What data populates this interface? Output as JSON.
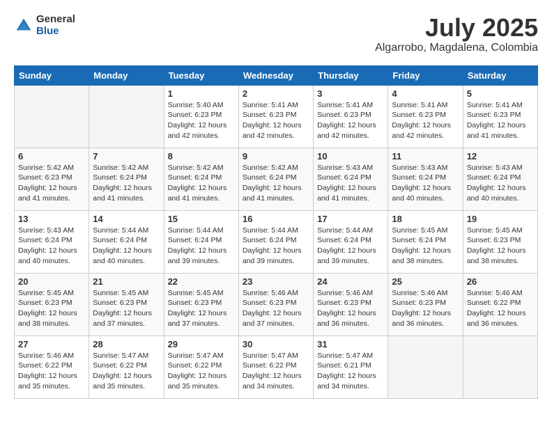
{
  "header": {
    "logo_general": "General",
    "logo_blue": "Blue",
    "month_year": "July 2025",
    "location": "Algarrobo, Magdalena, Colombia"
  },
  "weekdays": [
    "Sunday",
    "Monday",
    "Tuesday",
    "Wednesday",
    "Thursday",
    "Friday",
    "Saturday"
  ],
  "weeks": [
    [
      {
        "day": "",
        "info": ""
      },
      {
        "day": "",
        "info": ""
      },
      {
        "day": "1",
        "info": "Sunrise: 5:40 AM\nSunset: 6:23 PM\nDaylight: 12 hours and 42 minutes."
      },
      {
        "day": "2",
        "info": "Sunrise: 5:41 AM\nSunset: 6:23 PM\nDaylight: 12 hours and 42 minutes."
      },
      {
        "day": "3",
        "info": "Sunrise: 5:41 AM\nSunset: 6:23 PM\nDaylight: 12 hours and 42 minutes."
      },
      {
        "day": "4",
        "info": "Sunrise: 5:41 AM\nSunset: 6:23 PM\nDaylight: 12 hours and 42 minutes."
      },
      {
        "day": "5",
        "info": "Sunrise: 5:41 AM\nSunset: 6:23 PM\nDaylight: 12 hours and 41 minutes."
      }
    ],
    [
      {
        "day": "6",
        "info": "Sunrise: 5:42 AM\nSunset: 6:23 PM\nDaylight: 12 hours and 41 minutes."
      },
      {
        "day": "7",
        "info": "Sunrise: 5:42 AM\nSunset: 6:24 PM\nDaylight: 12 hours and 41 minutes."
      },
      {
        "day": "8",
        "info": "Sunrise: 5:42 AM\nSunset: 6:24 PM\nDaylight: 12 hours and 41 minutes."
      },
      {
        "day": "9",
        "info": "Sunrise: 5:42 AM\nSunset: 6:24 PM\nDaylight: 12 hours and 41 minutes."
      },
      {
        "day": "10",
        "info": "Sunrise: 5:43 AM\nSunset: 6:24 PM\nDaylight: 12 hours and 41 minutes."
      },
      {
        "day": "11",
        "info": "Sunrise: 5:43 AM\nSunset: 6:24 PM\nDaylight: 12 hours and 40 minutes."
      },
      {
        "day": "12",
        "info": "Sunrise: 5:43 AM\nSunset: 6:24 PM\nDaylight: 12 hours and 40 minutes."
      }
    ],
    [
      {
        "day": "13",
        "info": "Sunrise: 5:43 AM\nSunset: 6:24 PM\nDaylight: 12 hours and 40 minutes."
      },
      {
        "day": "14",
        "info": "Sunrise: 5:44 AM\nSunset: 6:24 PM\nDaylight: 12 hours and 40 minutes."
      },
      {
        "day": "15",
        "info": "Sunrise: 5:44 AM\nSunset: 6:24 PM\nDaylight: 12 hours and 39 minutes."
      },
      {
        "day": "16",
        "info": "Sunrise: 5:44 AM\nSunset: 6:24 PM\nDaylight: 12 hours and 39 minutes."
      },
      {
        "day": "17",
        "info": "Sunrise: 5:44 AM\nSunset: 6:24 PM\nDaylight: 12 hours and 39 minutes."
      },
      {
        "day": "18",
        "info": "Sunrise: 5:45 AM\nSunset: 6:24 PM\nDaylight: 12 hours and 38 minutes."
      },
      {
        "day": "19",
        "info": "Sunrise: 5:45 AM\nSunset: 6:23 PM\nDaylight: 12 hours and 38 minutes."
      }
    ],
    [
      {
        "day": "20",
        "info": "Sunrise: 5:45 AM\nSunset: 6:23 PM\nDaylight: 12 hours and 38 minutes."
      },
      {
        "day": "21",
        "info": "Sunrise: 5:45 AM\nSunset: 6:23 PM\nDaylight: 12 hours and 37 minutes."
      },
      {
        "day": "22",
        "info": "Sunrise: 5:45 AM\nSunset: 6:23 PM\nDaylight: 12 hours and 37 minutes."
      },
      {
        "day": "23",
        "info": "Sunrise: 5:46 AM\nSunset: 6:23 PM\nDaylight: 12 hours and 37 minutes."
      },
      {
        "day": "24",
        "info": "Sunrise: 5:46 AM\nSunset: 6:23 PM\nDaylight: 12 hours and 36 minutes."
      },
      {
        "day": "25",
        "info": "Sunrise: 5:46 AM\nSunset: 6:23 PM\nDaylight: 12 hours and 36 minutes."
      },
      {
        "day": "26",
        "info": "Sunrise: 5:46 AM\nSunset: 6:22 PM\nDaylight: 12 hours and 36 minutes."
      }
    ],
    [
      {
        "day": "27",
        "info": "Sunrise: 5:46 AM\nSunset: 6:22 PM\nDaylight: 12 hours and 35 minutes."
      },
      {
        "day": "28",
        "info": "Sunrise: 5:47 AM\nSunset: 6:22 PM\nDaylight: 12 hours and 35 minutes."
      },
      {
        "day": "29",
        "info": "Sunrise: 5:47 AM\nSunset: 6:22 PM\nDaylight: 12 hours and 35 minutes."
      },
      {
        "day": "30",
        "info": "Sunrise: 5:47 AM\nSunset: 6:22 PM\nDaylight: 12 hours and 34 minutes."
      },
      {
        "day": "31",
        "info": "Sunrise: 5:47 AM\nSunset: 6:21 PM\nDaylight: 12 hours and 34 minutes."
      },
      {
        "day": "",
        "info": ""
      },
      {
        "day": "",
        "info": ""
      }
    ]
  ]
}
